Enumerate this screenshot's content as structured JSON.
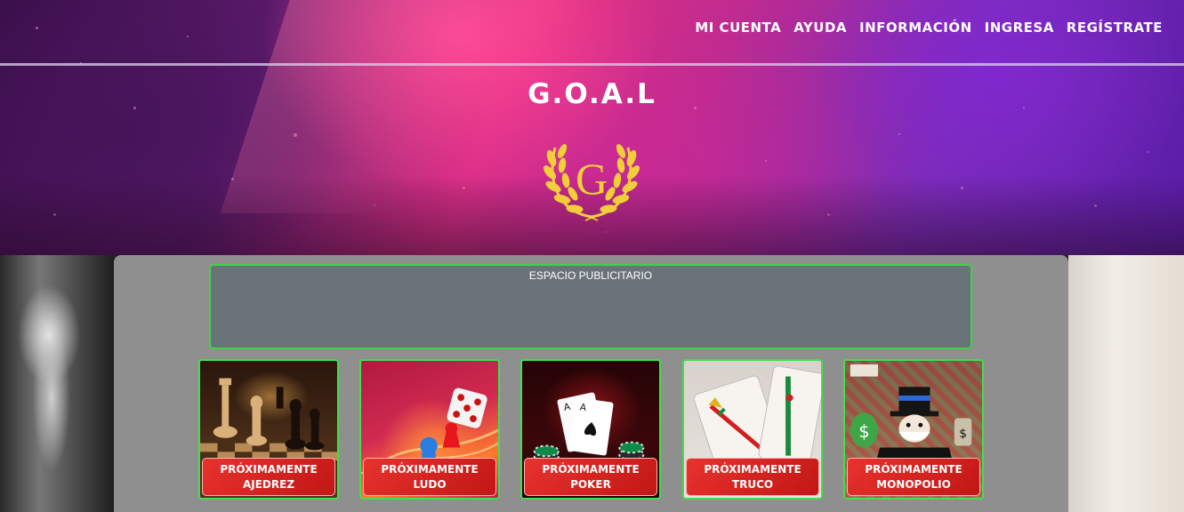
{
  "nav": {
    "items": [
      {
        "label": "MI CUENTA"
      },
      {
        "label": "AYUDA"
      },
      {
        "label": "INFORMACIÓN"
      },
      {
        "label": "INGRESA"
      },
      {
        "label": "REGÍSTRATE"
      }
    ]
  },
  "header": {
    "title": "G.O.A.L",
    "logo_letter": "G"
  },
  "ad": {
    "label": "ESPACIO PUBLICITARIO"
  },
  "games": [
    {
      "status": "PRÓXIMAMENTE",
      "name": "AJEDREZ"
    },
    {
      "status": "PRÓXIMAMENTE",
      "name": "LUDO"
    },
    {
      "status": "PRÓXIMAMENTE",
      "name": "POKER"
    },
    {
      "status": "PRÓXIMAMENTE",
      "name": "TRUCO"
    },
    {
      "status": "PRÓXIMAMENTE",
      "name": "MONOPOLIO"
    }
  ],
  "colors": {
    "accent_green": "#3fe04c",
    "label_red": "#d62624",
    "panel_gray": "#8f8f8f",
    "ad_slate": "#6a7378",
    "logo_gold": "#f2cf3a"
  }
}
